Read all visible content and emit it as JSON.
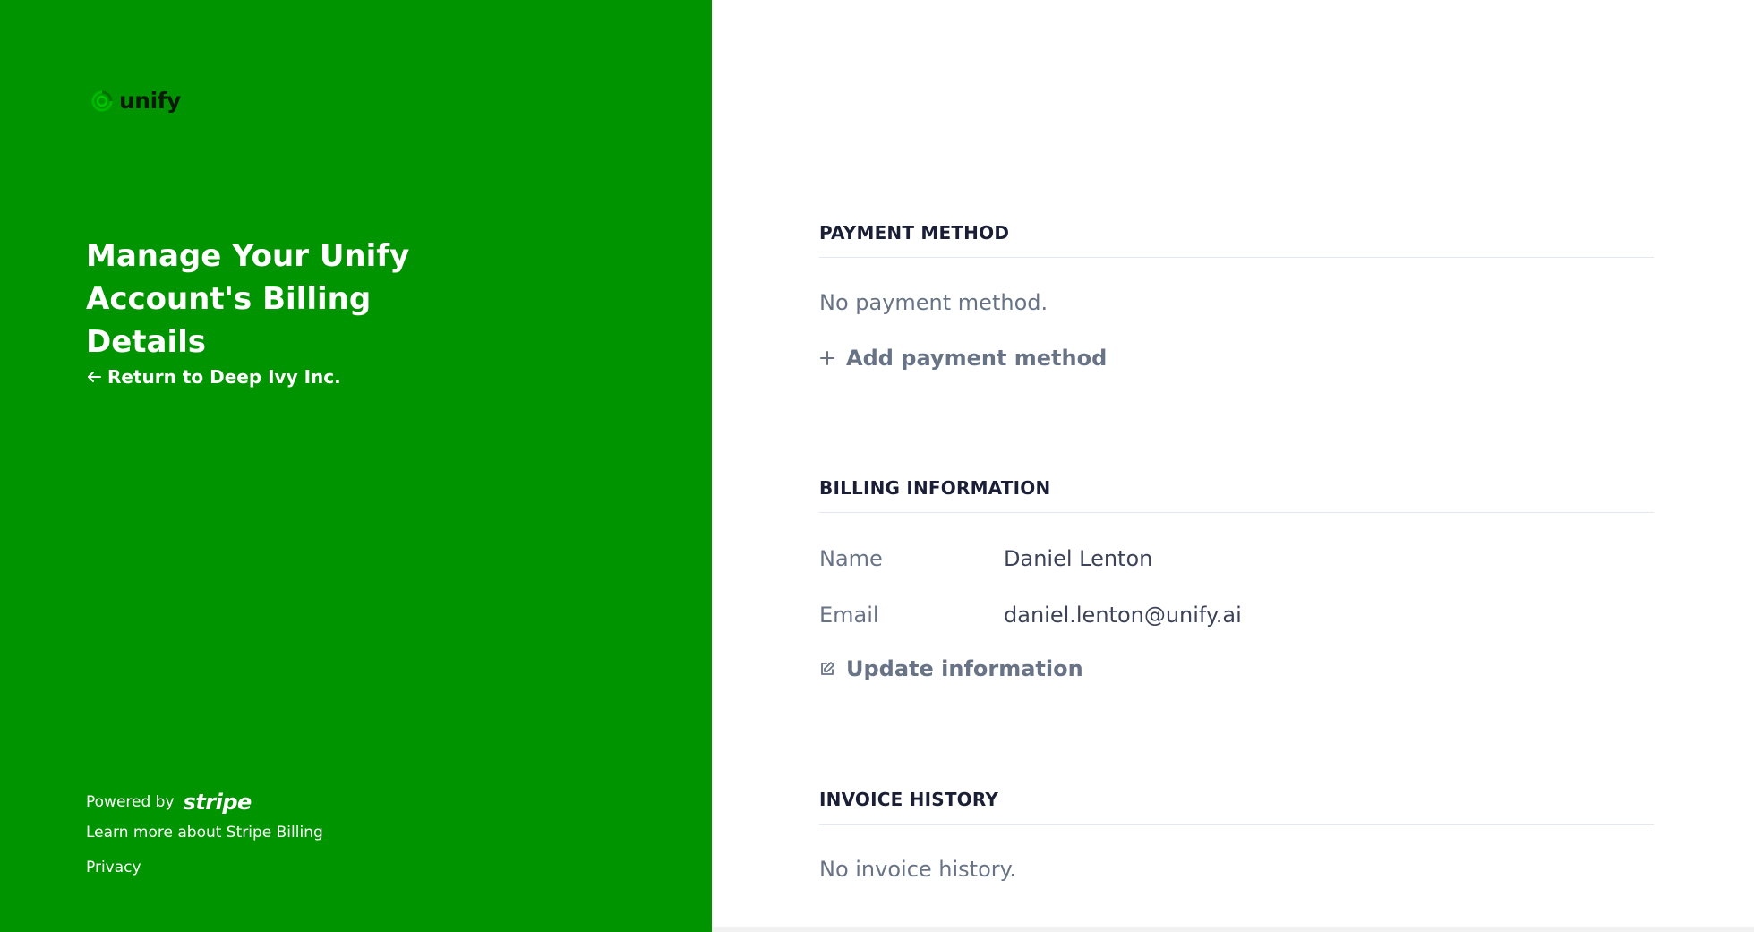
{
  "brand": {
    "name": "unify",
    "panel_color": "#009500"
  },
  "sidebar": {
    "headline": "Manage Your Unify Account's Billing Details",
    "return_link": "Return to Deep Ivy Inc.",
    "powered_by": "Powered by",
    "stripe": "stripe",
    "learn_more": "Learn more about Stripe Billing",
    "privacy": "Privacy"
  },
  "payment": {
    "title": "PAYMENT METHOD",
    "empty": "No payment method.",
    "add_label": "Add payment method"
  },
  "billing": {
    "title": "BILLING INFORMATION",
    "fields": [
      {
        "label": "Name",
        "value": "Daniel Lenton"
      },
      {
        "label": "Email",
        "value": "daniel.lenton@unify.ai"
      }
    ],
    "update_label": "Update information"
  },
  "invoices": {
    "title": "INVOICE HISTORY",
    "empty": "No invoice history."
  },
  "icons": {
    "logo": "swirl-logo-icon",
    "return": "arrow-left-icon",
    "add": "plus-icon",
    "update": "edit-icon"
  }
}
